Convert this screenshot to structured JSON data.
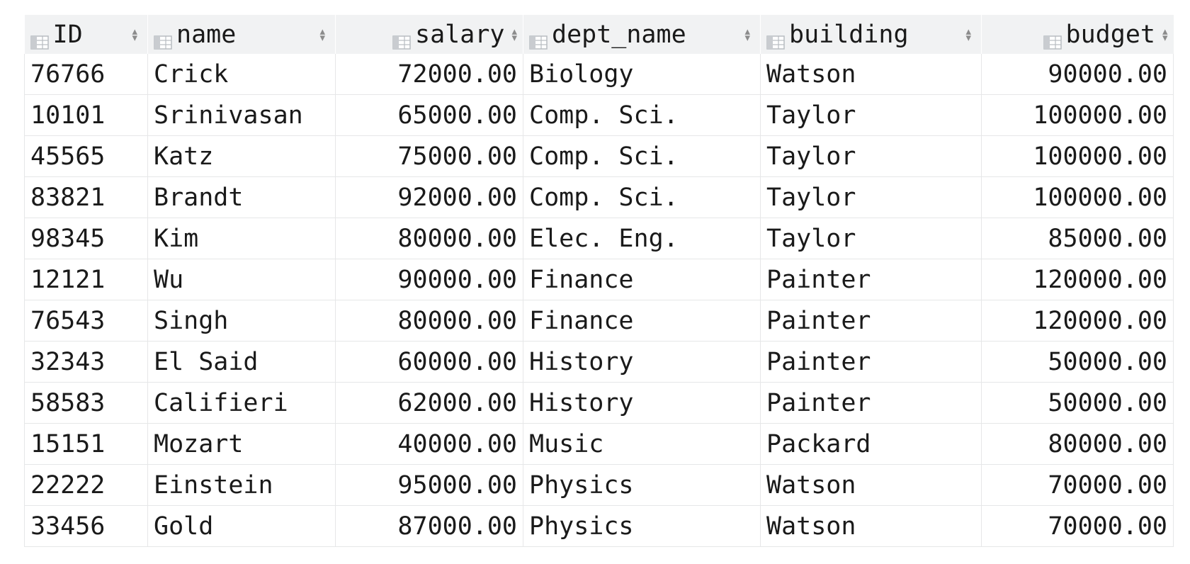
{
  "table": {
    "columns": [
      {
        "key": "id",
        "label": "ID",
        "align": "left",
        "icon": "column-icon",
        "sort_icon": "sort-icon"
      },
      {
        "key": "name",
        "label": "name",
        "align": "left",
        "icon": "column-icon",
        "sort_icon": "sort-icon"
      },
      {
        "key": "salary",
        "label": "salary",
        "align": "right",
        "icon": "column-icon",
        "sort_icon": "sort-icon"
      },
      {
        "key": "dept_name",
        "label": "dept_name",
        "align": "left",
        "icon": "column-icon",
        "sort_icon": "sort-icon"
      },
      {
        "key": "building",
        "label": "building",
        "align": "left",
        "icon": "column-icon",
        "sort_icon": "sort-icon"
      },
      {
        "key": "budget",
        "label": "budget",
        "align": "right",
        "icon": "column-icon",
        "sort_icon": "sort-icon"
      }
    ],
    "rows": [
      {
        "id": "76766",
        "name": "Crick",
        "salary": "72000.00",
        "dept_name": "Biology",
        "building": "Watson",
        "budget": "90000.00"
      },
      {
        "id": "10101",
        "name": "Srinivasan",
        "salary": "65000.00",
        "dept_name": "Comp. Sci.",
        "building": "Taylor",
        "budget": "100000.00"
      },
      {
        "id": "45565",
        "name": "Katz",
        "salary": "75000.00",
        "dept_name": "Comp. Sci.",
        "building": "Taylor",
        "budget": "100000.00"
      },
      {
        "id": "83821",
        "name": "Brandt",
        "salary": "92000.00",
        "dept_name": "Comp. Sci.",
        "building": "Taylor",
        "budget": "100000.00"
      },
      {
        "id": "98345",
        "name": "Kim",
        "salary": "80000.00",
        "dept_name": "Elec. Eng.",
        "building": "Taylor",
        "budget": "85000.00"
      },
      {
        "id": "12121",
        "name": "Wu",
        "salary": "90000.00",
        "dept_name": "Finance",
        "building": "Painter",
        "budget": "120000.00"
      },
      {
        "id": "76543",
        "name": "Singh",
        "salary": "80000.00",
        "dept_name": "Finance",
        "building": "Painter",
        "budget": "120000.00"
      },
      {
        "id": "32343",
        "name": "El Said",
        "salary": "60000.00",
        "dept_name": "History",
        "building": "Painter",
        "budget": "50000.00"
      },
      {
        "id": "58583",
        "name": "Califieri",
        "salary": "62000.00",
        "dept_name": "History",
        "building": "Painter",
        "budget": "50000.00"
      },
      {
        "id": "15151",
        "name": "Mozart",
        "salary": "40000.00",
        "dept_name": "Music",
        "building": "Packard",
        "budget": "80000.00"
      },
      {
        "id": "22222",
        "name": "Einstein",
        "salary": "95000.00",
        "dept_name": "Physics",
        "building": "Watson",
        "budget": "70000.00"
      },
      {
        "id": "33456",
        "name": "Gold",
        "salary": "87000.00",
        "dept_name": "Physics",
        "building": "Watson",
        "budget": "70000.00"
      }
    ]
  },
  "colors": {
    "header_bg": "#f1f2f3",
    "grid_line": "#e6e7e8",
    "icon_fill": "#c9ccd0",
    "text": "#1a1a1a"
  }
}
